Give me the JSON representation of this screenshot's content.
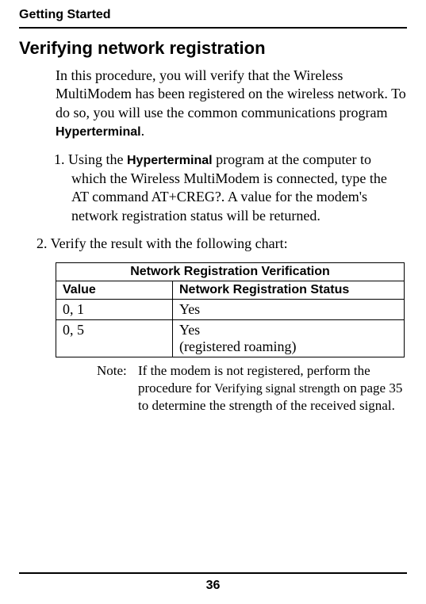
{
  "runningHead": "Getting Started",
  "sectionTitle": "Verifying network registration",
  "intro_pre": "In this procedure, you will verify that the Wireless MultiModem has been registered on the wireless network.  To do so, you will use the common communications program ",
  "intro_term": "Hyperterminal",
  "intro_post": ".",
  "step1_a": "1. Using the ",
  "step1_term": "Hyperterminal",
  "step1_b": " program at the computer to which the Wireless MultiModem is connected, type the AT command AT+CREG?.  A value for the modem's network registration status will be returned.",
  "step2": "2. Verify the result with the following chart:",
  "table": {
    "title": "Network Registration Verification",
    "headers": [
      "Value",
      "Network Registration Status"
    ],
    "rows": [
      [
        "0, 1",
        "Yes"
      ],
      [
        "0, 5",
        "Yes\n(registered roaming)"
      ]
    ]
  },
  "note_label": "Note:",
  "note_a": "If the modem is not registered, perform the procedure for ",
  "note_ref": "Verifying signal strength",
  "note_b": " on page 35 to determine the strength of the received signal.",
  "pageNumber": "36",
  "chart_data": {
    "type": "table",
    "title": "Network Registration Verification",
    "columns": [
      "Value",
      "Network Registration Status"
    ],
    "rows": [
      {
        "Value": "0, 1",
        "Network Registration Status": "Yes"
      },
      {
        "Value": "0, 5",
        "Network Registration Status": "Yes (registered roaming)"
      }
    ]
  }
}
